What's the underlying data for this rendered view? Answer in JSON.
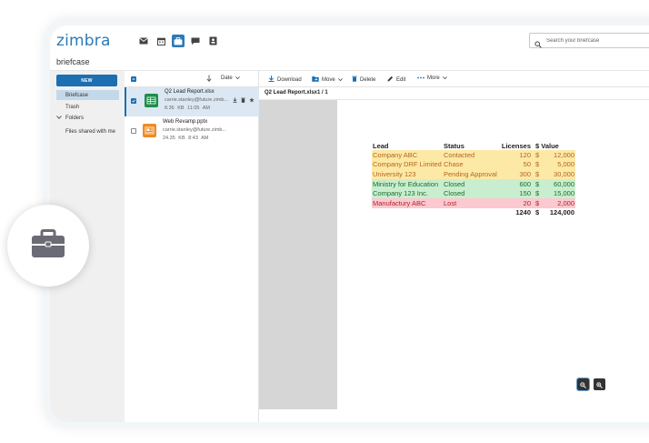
{
  "app": {
    "logo": "zimbra",
    "search_placeholder": "Search your briefcase",
    "section_title": "briefcase"
  },
  "app_icons": [
    "mail-icon",
    "calendar-icon",
    "briefcase-icon",
    "chat-icon",
    "contacts-icon"
  ],
  "sidebar": {
    "new_label": "NEW",
    "items": [
      {
        "label": "Briefcase",
        "selected": true
      },
      {
        "label": "Trash",
        "selected": false
      }
    ],
    "folders_label": "Folders",
    "shared_label": "Files shared with me"
  },
  "list": {
    "sort_label": "Date",
    "files": [
      {
        "name": "Q2 Lead Report.xlsx",
        "owner": "carrie.stanley@future.zimb...",
        "size": "8.36 KB",
        "time": "11:05 AM",
        "type": "xlsx",
        "selected": true
      },
      {
        "name": "Web Revamp.pptx",
        "owner": "carrie.stanley@future.zimb...",
        "size": "24.35 KB",
        "time": "8:43 AM",
        "type": "pptx",
        "selected": false
      }
    ]
  },
  "toolbar": {
    "download": "Download",
    "move": "Move",
    "delete": "Delete",
    "edit": "Edit",
    "more": "More"
  },
  "document": {
    "title": "Q2 Lead Report.xlsx",
    "page": "1 / 1"
  },
  "sheet": {
    "headers": [
      "Lead",
      "Status",
      "Licenses",
      "$ Value"
    ],
    "rows": [
      {
        "lead": "Company ABC",
        "status": "Contacted",
        "licenses": "120",
        "currency": "$",
        "value": "12,000",
        "color": "#fde9a6",
        "text": "#b5651d"
      },
      {
        "lead": "Company DRF Limited",
        "status": "Chase",
        "licenses": "50",
        "currency": "$",
        "value": "5,000",
        "color": "#fde9a6",
        "text": "#b5651d"
      },
      {
        "lead": "University 123",
        "status": "Pending Approval",
        "licenses": "300",
        "currency": "$",
        "value": "30,000",
        "color": "#fde9a6",
        "text": "#b5651d"
      },
      {
        "lead": "Ministry for Education",
        "status": "Closed",
        "licenses": "600",
        "currency": "$",
        "value": "60,000",
        "color": "#c9eecf",
        "text": "#1e6b2c"
      },
      {
        "lead": "Company 123 Inc.",
        "status": "Closed",
        "licenses": "150",
        "currency": "$",
        "value": "15,000",
        "color": "#c9eecf",
        "text": "#1e6b2c"
      },
      {
        "lead": "Manufactury ABC",
        "status": "Lost",
        "licenses": "20",
        "currency": "$",
        "value": "2,000",
        "color": "#fbc9cf",
        "text": "#b3202d"
      }
    ],
    "total": {
      "licenses": "1240",
      "currency": "$",
      "value": "124,000"
    }
  },
  "colors": {
    "accent": "#1b6fb2",
    "logo": "#2d7ab6",
    "badge_icon": "#6b6b76"
  }
}
